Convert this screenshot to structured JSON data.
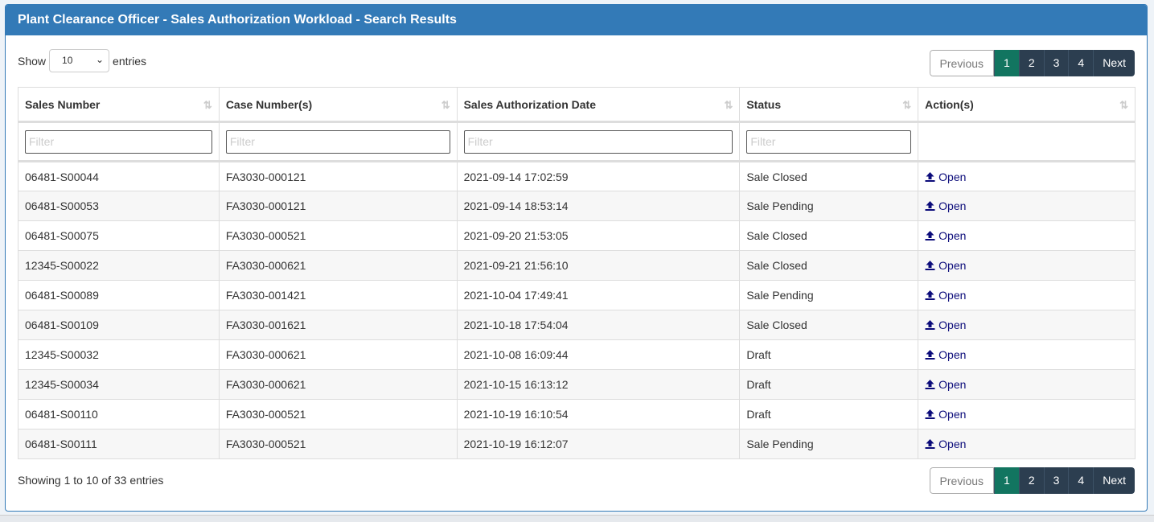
{
  "title": "Plant Clearance Officer - Sales Authorization Workload - Search Results",
  "length": {
    "show": "Show",
    "value": "10",
    "entries": "entries"
  },
  "pagination": {
    "previous": "Previous",
    "pages": [
      "1",
      "2",
      "3",
      "4"
    ],
    "active": "1",
    "next": "Next"
  },
  "columns": [
    "Sales Number",
    "Case Number(s)",
    "Sales Authorization Date",
    "Status",
    "Action(s)"
  ],
  "filter_placeholder": "Filter",
  "rows": [
    [
      "06481-S00044",
      "FA3030-000121",
      "2021-09-14 17:02:59",
      "Sale Closed",
      "Open"
    ],
    [
      "06481-S00053",
      "FA3030-000121",
      "2021-09-14 18:53:14",
      "Sale Pending",
      "Open"
    ],
    [
      "06481-S00075",
      "FA3030-000521",
      "2021-09-20 21:53:05",
      "Sale Closed",
      "Open"
    ],
    [
      "12345-S00022",
      "FA3030-000621",
      "2021-09-21 21:56:10",
      "Sale Closed",
      "Open"
    ],
    [
      "06481-S00089",
      "FA3030-001421",
      "2021-10-04 17:49:41",
      "Sale Pending",
      "Open"
    ],
    [
      "06481-S00109",
      "FA3030-001621",
      "2021-10-18 17:54:04",
      "Sale Closed",
      "Open"
    ],
    [
      "12345-S00032",
      "FA3030-000621",
      "2021-10-08 16:09:44",
      "Draft",
      "Open"
    ],
    [
      "12345-S00034",
      "FA3030-000621",
      "2021-10-15 16:13:12",
      "Draft",
      "Open"
    ],
    [
      "06481-S00110",
      "FA3030-000521",
      "2021-10-19 16:10:54",
      "Draft",
      "Open"
    ],
    [
      "06481-S00111",
      "FA3030-000521",
      "2021-10-19 16:12:07",
      "Sale Pending",
      "Open"
    ]
  ],
  "info": "Showing 1 to 10 of 33 entries",
  "colors": {
    "header": "#337ab7",
    "active_page": "#127560",
    "page": "#2c3e50",
    "link": "#0b0b7a"
  }
}
